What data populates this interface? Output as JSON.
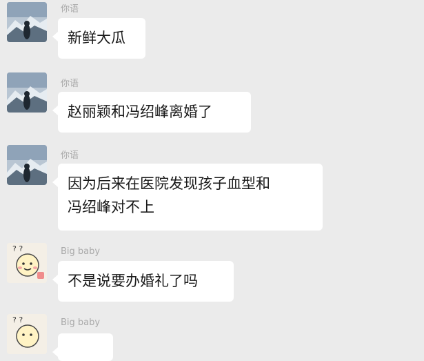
{
  "chat": {
    "messages": [
      {
        "sender": "你语",
        "avatar_icon": "mountain-avatar-icon",
        "lines": [
          "新鲜大瓜"
        ]
      },
      {
        "sender": "你语",
        "avatar_icon": "mountain-avatar-icon",
        "lines": [
          "赵丽颖和冯绍峰离婚了"
        ]
      },
      {
        "sender": "你语",
        "avatar_icon": "mountain-avatar-icon",
        "lines": [
          "因为后来在医院发现孩子血型和",
          "冯绍峰对不上"
        ]
      },
      {
        "sender": "Big baby",
        "avatar_icon": "cartoon-baby-avatar-icon",
        "lines": [
          "不是说要办婚礼了吗"
        ]
      },
      {
        "sender": "Big baby",
        "avatar_icon": "cartoon-baby-avatar-icon",
        "lines": []
      }
    ]
  },
  "colors": {
    "background": "#ebebeb",
    "bubble": "#ffffff",
    "sender_text": "#a9a9a9",
    "message_text": "#1a1a1a"
  }
}
